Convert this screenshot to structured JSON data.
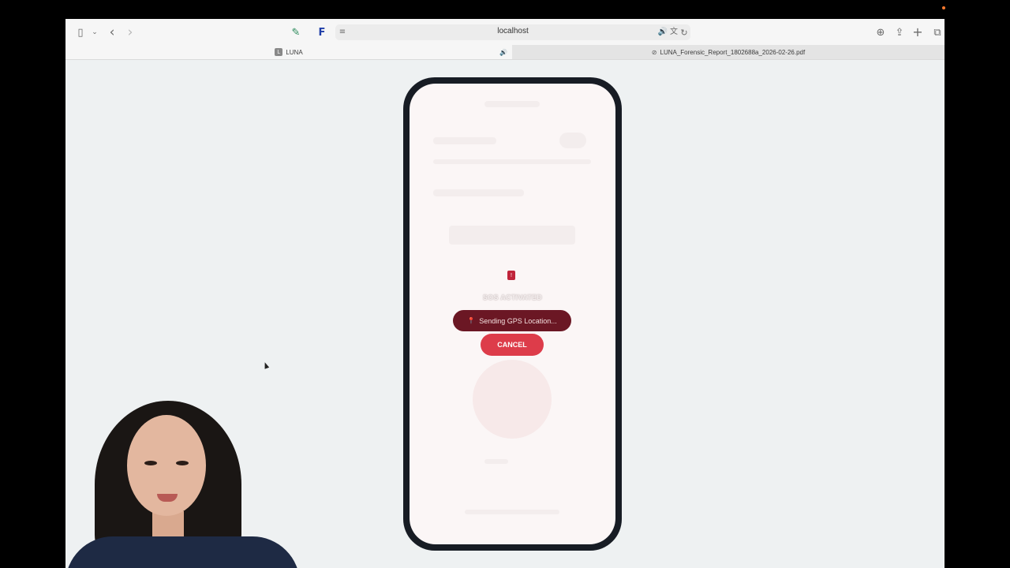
{
  "browser": {
    "url": "localhost",
    "tabs": [
      {
        "title": "LUNA",
        "favicon": "L"
      },
      {
        "title": "LUNA_Forensic_Report_1802688a_2026-02-26.pdf"
      }
    ],
    "icons": {
      "sidebar": "▯",
      "sidebar_chevron": "⌄",
      "back": "‹",
      "forward": "›",
      "extension_pen": "✎",
      "extension_f": "F",
      "page_menu": "≡",
      "audio": "🔊",
      "translate": "文",
      "reload": "↻",
      "downloads": "⊕",
      "share": "⇪",
      "new_tab": "+",
      "tab_overview": "⧉",
      "tab_audio": "🔊",
      "pdf": "⊘"
    }
  },
  "app": {
    "status_label": "SOS ACTIVATED",
    "gps_status": "Sending GPS Location...",
    "gps_icon": "📍",
    "cancel_label": "CANCEL",
    "alert_icon": "!"
  },
  "colors": {
    "sos_dark": "#6b1724",
    "cancel_red": "#dd3c4a",
    "phone_frame": "#171c24"
  }
}
